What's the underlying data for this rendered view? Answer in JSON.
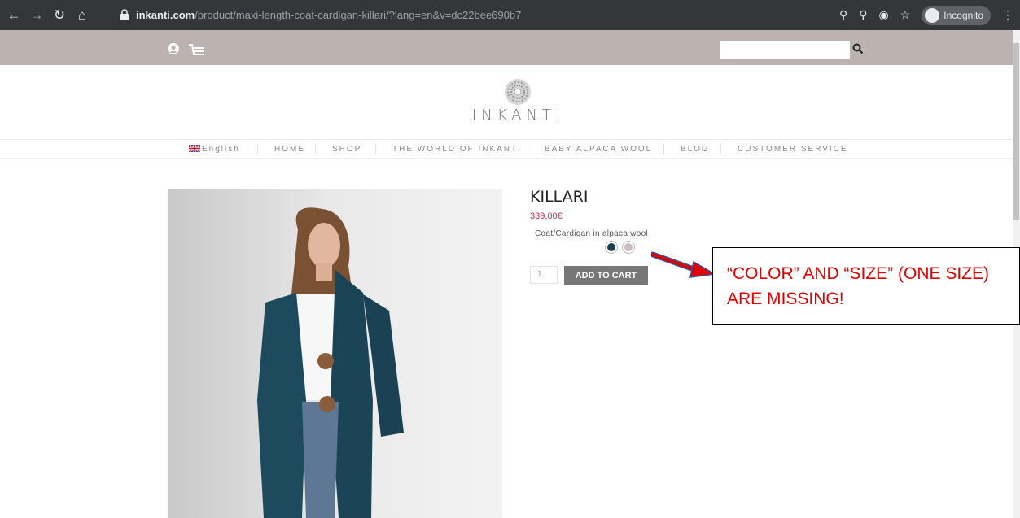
{
  "browser": {
    "url_host": "inkanti.com",
    "url_path": "/product/maxi-length-coat-cardigan-killari/?lang=en&v=dc22bee690b7",
    "incognito_label": "Incognito"
  },
  "site": {
    "logo_text": "INKANTI",
    "search_placeholder": ""
  },
  "menu": {
    "items": [
      {
        "label": "English"
      },
      {
        "label": "HOME"
      },
      {
        "label": "SHOP"
      },
      {
        "label": "THE WORLD OF INKANTI"
      },
      {
        "label": "BABY ALPACA WOOL"
      },
      {
        "label": "BLOG"
      },
      {
        "label": "CUSTOMER SERVICE"
      }
    ]
  },
  "product": {
    "title": "KILLARI",
    "price": "339,00€",
    "description": "Coat/Cardigan in alpaca wool",
    "swatches": [
      "#1d4052",
      "#cbbcc2"
    ],
    "quantity": "1",
    "add_to_cart_label": "ADD TO CART"
  },
  "annotation": {
    "text": "“COLOR” AND “SIZE” (ONE SIZE) ARE MISSING!",
    "color": "#e30000"
  },
  "colors": {
    "topbar": "#bcb3b0",
    "price": "#b5314a",
    "button": "#777777"
  }
}
